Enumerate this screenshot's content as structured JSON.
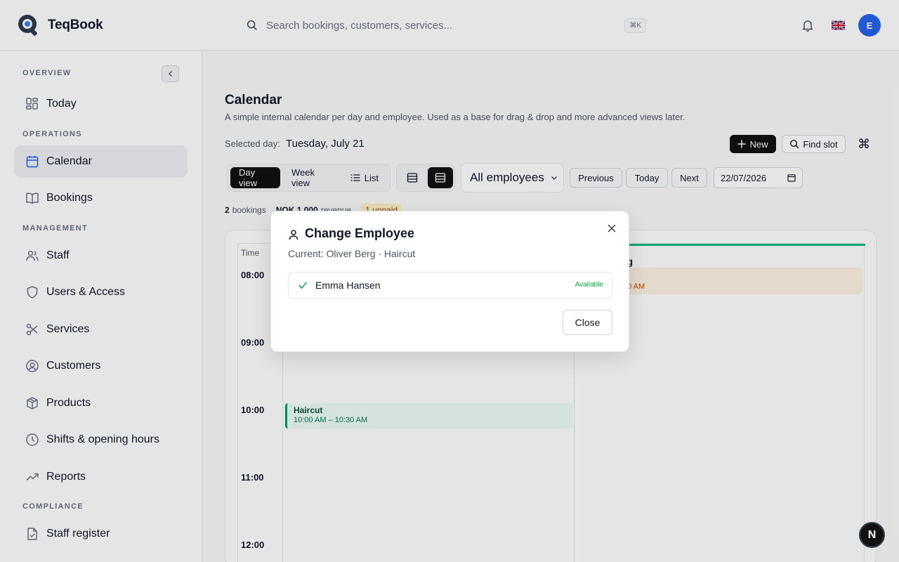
{
  "app": {
    "name": "TeqBook"
  },
  "header": {
    "search_placeholder": "Search bookings, customers, services...",
    "search_shortcut": "⌘K",
    "avatar_initial": "E"
  },
  "sidebar": {
    "sections": {
      "overview": "OVERVIEW",
      "operations": "OPERATIONS",
      "management": "MANAGEMENT",
      "compliance": "COMPLIANCE"
    },
    "items": [
      {
        "label": "Today",
        "icon": "dashboard-icon"
      },
      {
        "label": "Calendar",
        "icon": "calendar-icon",
        "active": true
      },
      {
        "label": "Bookings",
        "icon": "book-icon"
      },
      {
        "label": "Staff",
        "icon": "users-icon"
      },
      {
        "label": "Users & Access",
        "icon": "shield-icon"
      },
      {
        "label": "Services",
        "icon": "scissors-icon"
      },
      {
        "label": "Customers",
        "icon": "user-circle-icon"
      },
      {
        "label": "Products",
        "icon": "package-icon"
      },
      {
        "label": "Shifts & opening hours",
        "icon": "clock-icon"
      },
      {
        "label": "Reports",
        "icon": "trending-up-icon"
      },
      {
        "label": "Staff register",
        "icon": "file-check-icon"
      }
    ]
  },
  "page": {
    "title": "Calendar",
    "subtitle": "A simple internal calendar per day and employee. Used as a base for drag & drop and more advanced views later.",
    "selected_day_label": "Selected day:",
    "selected_day_value": "Tuesday, July 21",
    "new_label": "New",
    "find_slot_label": "Find slot"
  },
  "toolbar": {
    "views": [
      "Day view",
      "Week view",
      "List"
    ],
    "active_view": "Day view",
    "employee_filter": "All employees",
    "previous": "Previous",
    "today": "Today",
    "next": "Next",
    "date": "22/07/2026"
  },
  "stats": {
    "bookings_count": "2",
    "bookings_label": "bookings",
    "revenue": "NOK 1,000",
    "revenue_label": "revenue",
    "unpaid": "1 unpaid"
  },
  "calendar": {
    "time_header": "Time",
    "hours": [
      "08:00",
      "09:00",
      "10:00",
      "11:00",
      "12:00"
    ],
    "column2_name_partial": "rg",
    "booking1_time_partial": "30 AM",
    "booking2": {
      "title": "Haircut",
      "time": "10:00 AM – 10:30 AM"
    }
  },
  "dialog": {
    "title": "Change Employee",
    "subtitle": "Current: Oliver Berg · Haircut",
    "employee": {
      "name": "Emma Hansen",
      "status": "Available"
    },
    "close_label": "Close"
  },
  "fab": {
    "label": "N"
  },
  "colors": {
    "accent_dark": "#111111",
    "avatar": "#2563eb",
    "available": "#16a34a",
    "booking_border": "#059669"
  }
}
